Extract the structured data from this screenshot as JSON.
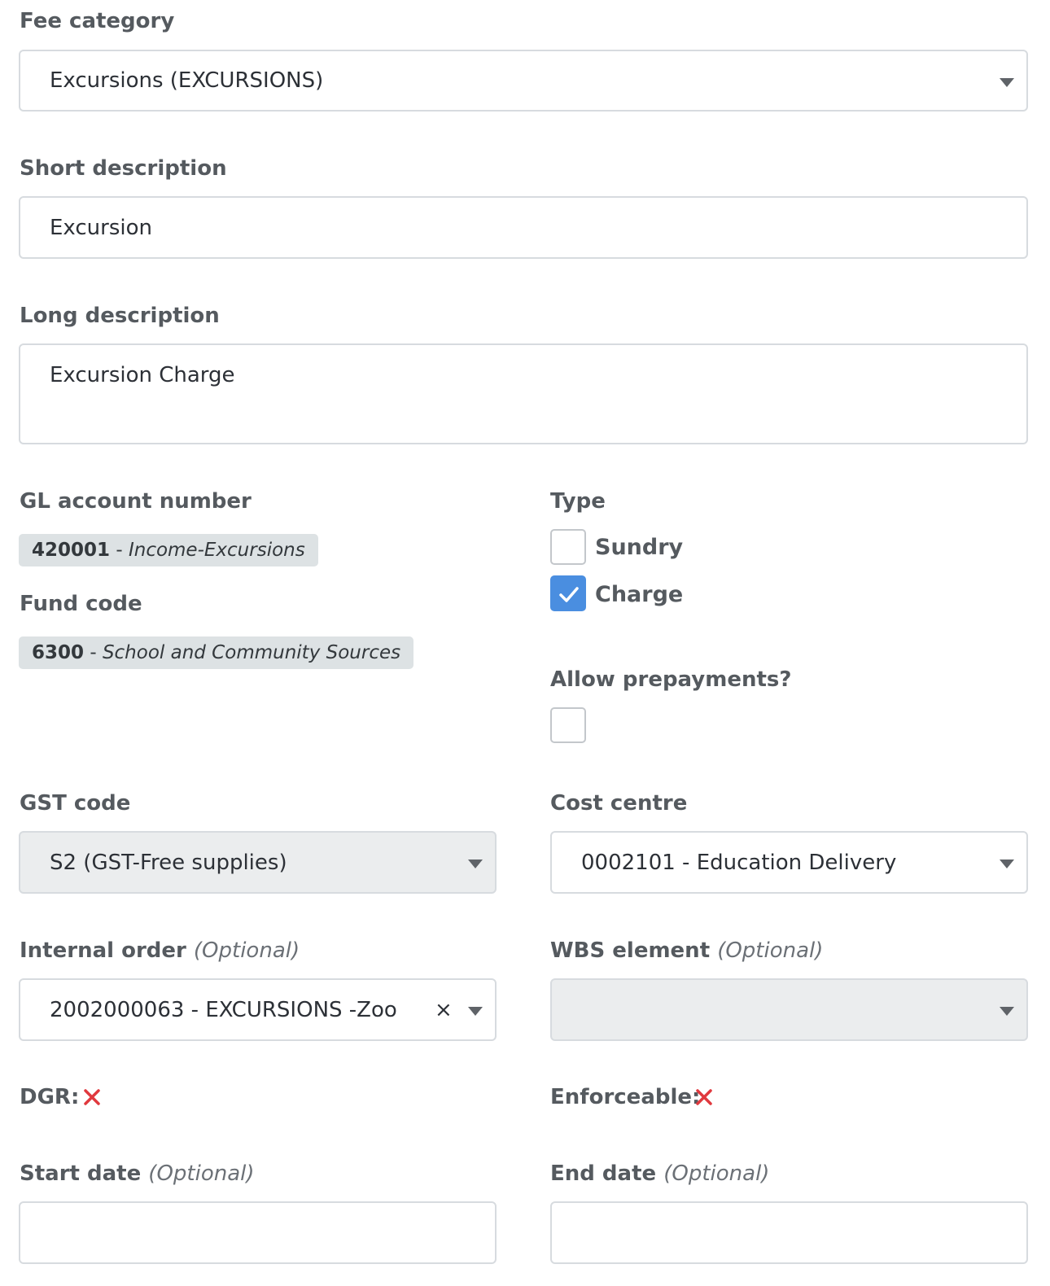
{
  "fee_category": {
    "label": "Fee category",
    "value": "Excursions (EXCURSIONS)"
  },
  "short_description": {
    "label": "Short description",
    "value": "Excursion"
  },
  "long_description": {
    "label": "Long description",
    "value": "Excursion Charge"
  },
  "gl_account": {
    "label": "GL account number",
    "code": "420001",
    "separator": " - ",
    "name": "Income-Excursions"
  },
  "fund_code": {
    "label": "Fund code",
    "code": "6300",
    "separator": " - ",
    "name": "School and Community Sources"
  },
  "type": {
    "label": "Type",
    "options": [
      {
        "label": "Sundry",
        "checked": false
      },
      {
        "label": "Charge",
        "checked": true
      }
    ]
  },
  "allow_prepayments": {
    "label": "Allow prepayments?",
    "checked": false
  },
  "gst_code": {
    "label": "GST code",
    "value": "S2 (GST-Free supplies)",
    "disabled": true
  },
  "cost_centre": {
    "label": "Cost centre",
    "value": "0002101 - Education Delivery"
  },
  "internal_order": {
    "label": "Internal order",
    "optional": "(Optional)",
    "value": "2002000063 - EXCURSIONS -Zoo",
    "clear": "×"
  },
  "wbs_element": {
    "label": "WBS element",
    "optional": "(Optional)",
    "value": "",
    "disabled": true
  },
  "dgr": {
    "label": "DGR:",
    "value": false
  },
  "enforceable": {
    "label": "Enforceable:",
    "value": false
  },
  "start_date": {
    "label": "Start date",
    "optional": "(Optional)",
    "value": ""
  },
  "end_date": {
    "label": "End date",
    "optional": "(Optional)",
    "value": ""
  },
  "colors": {
    "checkbox_checked": "#4a8ee0",
    "cross_red": "#e0393e",
    "disabled_bg": "#ebedee",
    "chip_bg": "#dde2e4"
  }
}
